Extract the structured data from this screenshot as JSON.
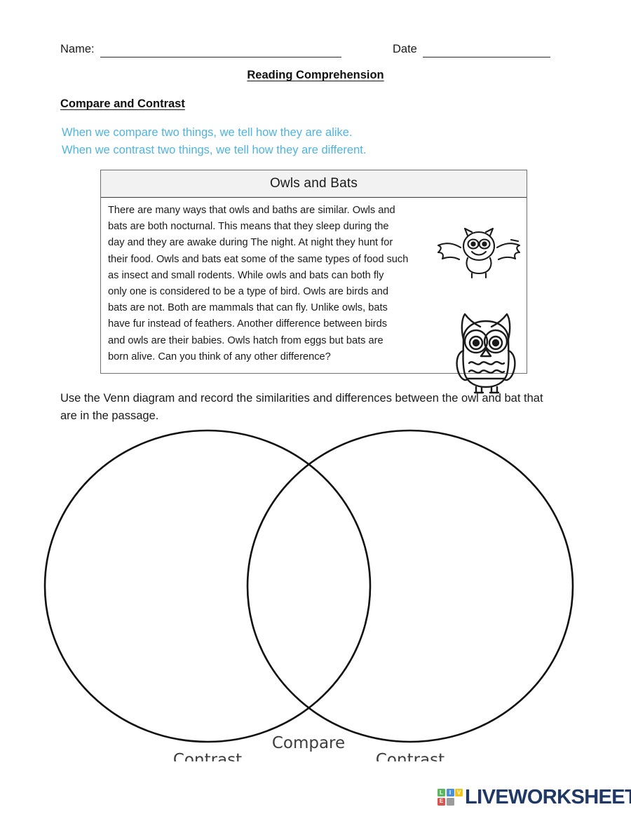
{
  "header": {
    "name_label": "Name:",
    "date_label": "Date",
    "name_value": "",
    "date_value": ""
  },
  "doc_title": "Reading Comprehension",
  "section_title": "Compare and Contrast",
  "intro": {
    "line1": "When we compare two things, we tell how they are alike.",
    "line2": "When we contrast two things, we tell how they are different.",
    "color": "#4fb4dd"
  },
  "passage": {
    "title": "Owls and Bats",
    "body": "There are many ways that owls and baths are similar.  Owls and\nbats are both nocturnal.  This means that they sleep during the\nday and they are awake during The night.  At night they hunt for\ntheir food.  Owls and bats eat some of the same types of food such\nas insect and small rodents.  While owls and bats can both fly\nonly one is considered to be a type of bird.  Owls are birds and\nbats are not.  Both are mammals that can fly.  Unlike owls, bats\nhave fur instead of feathers.  Another difference between birds\nand owls are their babies.  Owls hatch from eggs but bats are\n born alive.  Can you think of any other difference?",
    "bat_image_alt": "bat-illustration",
    "owl_image_alt": "owl-illustration"
  },
  "venn_instructions": "Use the Venn diagram and record the similarities and differences between the owl and bat that are in the passage.",
  "venn": {
    "left_label": "Contrast",
    "center_label": "Compare",
    "right_label": "Contrast"
  },
  "logo": {
    "wordmark": "LIVEWORKSHEETS",
    "tiles": [
      {
        "letter": "L",
        "color": "#5cb85c"
      },
      {
        "letter": "I",
        "color": "#4a90d9"
      },
      {
        "letter": "V",
        "color": "#f0c419"
      },
      {
        "letter": "E",
        "color": "#d9534f"
      },
      {
        "letter": "",
        "color": "#9b9b9b"
      },
      {
        "letter": "",
        "color": "#ffffff"
      }
    ],
    "wordmark_color": "#1f3864"
  }
}
